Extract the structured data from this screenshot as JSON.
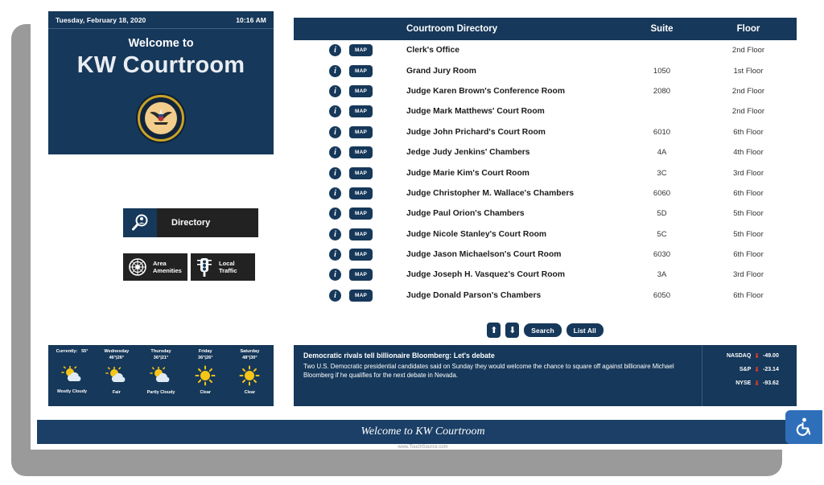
{
  "welcome": {
    "date": "Tuesday, February 18, 2020",
    "time": "10:16 AM",
    "greeting": "Welcome to",
    "venue": "KW Courtroom"
  },
  "nav": {
    "directory": "Directory",
    "amenities_line1": "Area",
    "amenities_line2": "Amenities",
    "traffic_line1": "Local",
    "traffic_line2": "Traffic"
  },
  "directory": {
    "headers": {
      "name": "Courtroom Directory",
      "suite": "Suite",
      "floor": "Floor"
    },
    "info_glyph": "i",
    "map_label": "MAP",
    "rows": [
      {
        "name": "Clerk's Office",
        "suite": "",
        "floor": "2nd Floor"
      },
      {
        "name": "Grand Jury Room",
        "suite": "1050",
        "floor": "1st Floor"
      },
      {
        "name": "Judge Karen Brown's Conference Room",
        "suite": "2080",
        "floor": "2nd Floor"
      },
      {
        "name": "Judge Mark Matthews' Court Room",
        "suite": "",
        "floor": "2nd Floor"
      },
      {
        "name": "Judge John Prichard's Court Room",
        "suite": "6010",
        "floor": "6th Floor"
      },
      {
        "name": "Jedge Judy Jenkins' Chambers",
        "suite": "4A",
        "floor": "4th Floor"
      },
      {
        "name": "Judge Marie Kim's Court Room",
        "suite": "3C",
        "floor": "3rd Floor"
      },
      {
        "name": "Judge Christopher M. Wallace's Chambers",
        "suite": "6060",
        "floor": "6th Floor"
      },
      {
        "name": "Judge Paul Orion's Chambers",
        "suite": "5D",
        "floor": "5th Floor"
      },
      {
        "name": "Judge Nicole Stanley's Court Room",
        "suite": "5C",
        "floor": "5th Floor"
      },
      {
        "name": "Judge Jason Michaelson's Court Room",
        "suite": "6030",
        "floor": "6th Floor"
      },
      {
        "name": "Judge Joseph H. Vasquez's Court Room",
        "suite": "3A",
        "floor": "3rd Floor"
      },
      {
        "name": "Judge Donald Parson's Chambers",
        "suite": "6050",
        "floor": "6th Floor"
      }
    ]
  },
  "pager": {
    "up": "⬆",
    "down": "⬇",
    "search": "Search",
    "list_all": "List All"
  },
  "weather": {
    "current_label": "Currently:",
    "current_temp": "55°",
    "current_condition": "Mostly Cloudy",
    "current_icon": "sun-cloud-icon",
    "days": [
      {
        "day": "Wednesday",
        "temps": "46°|26°",
        "condition": "Fair",
        "icon": "sun-cloud-icon"
      },
      {
        "day": "Thursday",
        "temps": "36°|21°",
        "condition": "Partly Cloudy",
        "icon": "sun-cloud-icon"
      },
      {
        "day": "Friday",
        "temps": "36°|26°",
        "condition": "Clear",
        "icon": "sun-icon"
      },
      {
        "day": "Saturday",
        "temps": "48°|30°",
        "condition": "Clear",
        "icon": "sun-icon"
      }
    ]
  },
  "news": {
    "headline": "Democratic rivals tell billionaire Bloomberg: Let's debate",
    "body": "Two U.S. Democratic presidential candidates said on Sunday they would welcome the chance to square off against billionaire Michael Bloomberg if he qualifies for the next debate in Nevada."
  },
  "stocks": [
    {
      "symbol": "NASDAQ",
      "direction": "down",
      "change": "-49.00"
    },
    {
      "symbol": "S&P",
      "direction": "down",
      "change": "-23.14"
    },
    {
      "symbol": "NYSE",
      "direction": "down",
      "change": "-93.62"
    }
  ],
  "footer": {
    "banner": "Welcome to KW Courtroom",
    "url": "www.TouchSource.com"
  },
  "colors": {
    "navy": "#16385a",
    "footer_navy": "#1b3f66",
    "dark_button": "#222222",
    "accessibility_blue": "#2f6fba",
    "stock_down_red": "#d23a2e",
    "seal_gold": "#c9a227"
  }
}
